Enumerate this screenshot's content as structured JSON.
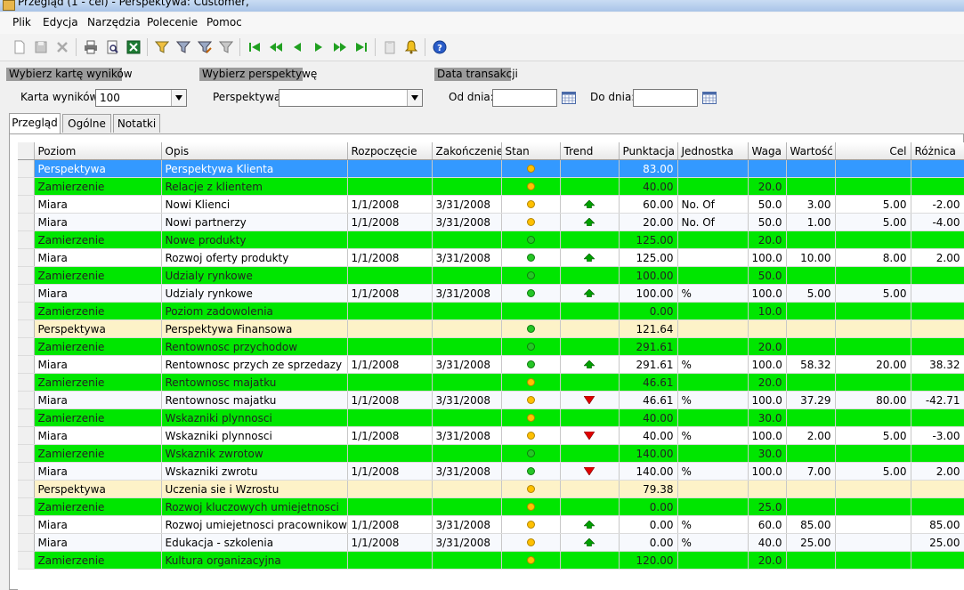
{
  "window": {
    "title": "Przegląd (1 - cel) - Perspektywa: Customer,"
  },
  "menu": [
    "Plik",
    "Edycja",
    "Narzędzia",
    "Polecenie",
    "Pomoc"
  ],
  "toolbar": [
    "new-icon",
    "save-icon",
    "delete-icon",
    "print-icon",
    "print-preview-icon",
    "excel-export-icon",
    "filter-icon",
    "filter-apply-icon",
    "filter-edit-icon",
    "filter-clear-icon",
    "first-record-icon",
    "previous-page-icon",
    "previous-record-icon",
    "next-record-icon",
    "next-page-icon",
    "last-record-icon",
    "attachment-icon",
    "alert-bell-icon",
    "help-icon"
  ],
  "filters": {
    "scorecard": {
      "section": "Wybierz kartę wyników",
      "label": "Karta wyników:",
      "value": "100"
    },
    "perspective": {
      "section": "Wybierz perspektywę",
      "label": "Perspektywa:",
      "value": ""
    },
    "date": {
      "section": "Data transakcji",
      "from_label": "Od dnia:",
      "to_label": "Do dnia:",
      "from_value": "",
      "to_value": ""
    }
  },
  "tabs": [
    "Przegląd",
    "Ogólne",
    "Notatki"
  ],
  "colors": {
    "perspektywa": "#fdf2c8",
    "zamierzenie": "#00e600",
    "selected": "#3399ff",
    "status_yellow": "#ffc000",
    "status_green": "#26c626",
    "trend_up": "#00a000",
    "trend_down": "#e00000"
  },
  "grid": {
    "columns": [
      "Poziom",
      "Opis",
      "Rozpoczęcie",
      "Zakończenie",
      "Stan",
      "Trend",
      "Punktacja",
      "Jednostka",
      "Waga",
      "Wartość",
      "Cel",
      "Różnica"
    ],
    "rows": [
      {
        "type": "perspektywa",
        "selected": true,
        "poziom": "Perspektywa",
        "opis": "Perspektywa Klienta",
        "start": "",
        "end": "",
        "stan": "yellow",
        "trend": "",
        "punktacja": "83.00",
        "jednostka": "",
        "waga": "",
        "wartosc": "",
        "cel": "",
        "roznica": ""
      },
      {
        "type": "zamierzenie",
        "poziom": "Zamierzenie",
        "opis": "Relacje z klientem",
        "start": "",
        "end": "",
        "stan": "yellow",
        "trend": "",
        "punktacja": "40.00",
        "jednostka": "",
        "waga": "20.0",
        "wartosc": "",
        "cel": "",
        "roznica": ""
      },
      {
        "type": "miara",
        "poziom": "Miara",
        "opis": "Nowi Klienci",
        "start": "1/1/2008",
        "end": "3/31/2008",
        "stan": "yellow",
        "trend": "up",
        "punktacja": "60.00",
        "jednostka": "No. Of",
        "waga": "50.0",
        "wartosc": "3.00",
        "cel": "5.00",
        "roznica": "-2.00"
      },
      {
        "type": "miara",
        "poziom": "Miara",
        "opis": "Nowi partnerzy",
        "start": "1/1/2008",
        "end": "3/31/2008",
        "stan": "yellow",
        "trend": "up",
        "punktacja": "20.00",
        "jednostka": "No. Of",
        "waga": "50.0",
        "wartosc": "1.00",
        "cel": "5.00",
        "roznica": "-4.00"
      },
      {
        "type": "zamierzenie",
        "poziom": "Zamierzenie",
        "opis": "Nowe produkty",
        "start": "",
        "end": "",
        "stan": "green",
        "trend": "",
        "punktacja": "125.00",
        "jednostka": "",
        "waga": "20.0",
        "wartosc": "",
        "cel": "",
        "roznica": ""
      },
      {
        "type": "miara",
        "poziom": "Miara",
        "opis": "Rozwoj oferty produkty",
        "start": "1/1/2008",
        "end": "3/31/2008",
        "stan": "green",
        "trend": "up",
        "punktacja": "125.00",
        "jednostka": "",
        "waga": "100.0",
        "wartosc": "10.00",
        "cel": "8.00",
        "roznica": "2.00"
      },
      {
        "type": "zamierzenie",
        "poziom": "Zamierzenie",
        "opis": "Udzialy rynkowe",
        "start": "",
        "end": "",
        "stan": "green",
        "trend": "",
        "punktacja": "100.00",
        "jednostka": "",
        "waga": "50.0",
        "wartosc": "",
        "cel": "",
        "roznica": ""
      },
      {
        "type": "miara",
        "poziom": "Miara",
        "opis": "Udzialy rynkowe",
        "start": "1/1/2008",
        "end": "3/31/2008",
        "stan": "green",
        "trend": "up",
        "punktacja": "100.00",
        "jednostka": "%",
        "waga": "100.0",
        "wartosc": "5.00",
        "cel": "5.00",
        "roznica": ""
      },
      {
        "type": "zamierzenie",
        "poziom": "Zamierzenie",
        "opis": "Poziom zadowolenia",
        "start": "",
        "end": "",
        "stan": "",
        "trend": "",
        "punktacja": "0.00",
        "jednostka": "",
        "waga": "10.0",
        "wartosc": "",
        "cel": "",
        "roznica": ""
      },
      {
        "type": "perspektywa",
        "poziom": "Perspektywa",
        "opis": "Perspektywa Finansowa",
        "start": "",
        "end": "",
        "stan": "green",
        "trend": "",
        "punktacja": "121.64",
        "jednostka": "",
        "waga": "",
        "wartosc": "",
        "cel": "",
        "roznica": ""
      },
      {
        "type": "zamierzenie",
        "poziom": "Zamierzenie",
        "opis": "Rentownosc przychodow",
        "start": "",
        "end": "",
        "stan": "green",
        "trend": "",
        "punktacja": "291.61",
        "jednostka": "",
        "waga": "20.0",
        "wartosc": "",
        "cel": "",
        "roznica": ""
      },
      {
        "type": "miara",
        "poziom": "Miara",
        "opis": "Rentownosc przych ze sprzedazy",
        "start": "1/1/2008",
        "end": "3/31/2008",
        "stan": "green",
        "trend": "up",
        "punktacja": "291.61",
        "jednostka": "%",
        "waga": "100.0",
        "wartosc": "58.32",
        "cel": "20.00",
        "roznica": "38.32"
      },
      {
        "type": "zamierzenie",
        "poziom": "Zamierzenie",
        "opis": "Rentownosc majatku",
        "start": "",
        "end": "",
        "stan": "yellow",
        "trend": "",
        "punktacja": "46.61",
        "jednostka": "",
        "waga": "20.0",
        "wartosc": "",
        "cel": "",
        "roznica": ""
      },
      {
        "type": "miara",
        "poziom": "Miara",
        "opis": "Rentownosc majatku",
        "start": "1/1/2008",
        "end": "3/31/2008",
        "stan": "yellow",
        "trend": "down",
        "punktacja": "46.61",
        "jednostka": "%",
        "waga": "100.0",
        "wartosc": "37.29",
        "cel": "80.00",
        "roznica": "-42.71"
      },
      {
        "type": "zamierzenie",
        "poziom": "Zamierzenie",
        "opis": "Wskazniki plynnosci",
        "start": "",
        "end": "",
        "stan": "yellow",
        "trend": "",
        "punktacja": "40.00",
        "jednostka": "",
        "waga": "30.0",
        "wartosc": "",
        "cel": "",
        "roznica": ""
      },
      {
        "type": "miara",
        "poziom": "Miara",
        "opis": "Wskazniki plynnosci",
        "start": "1/1/2008",
        "end": "3/31/2008",
        "stan": "yellow",
        "trend": "down",
        "punktacja": "40.00",
        "jednostka": "%",
        "waga": "100.0",
        "wartosc": "2.00",
        "cel": "5.00",
        "roznica": "-3.00"
      },
      {
        "type": "zamierzenie",
        "poziom": "Zamierzenie",
        "opis": "Wskaznik zwrotow",
        "start": "",
        "end": "",
        "stan": "green",
        "trend": "",
        "punktacja": "140.00",
        "jednostka": "",
        "waga": "30.0",
        "wartosc": "",
        "cel": "",
        "roznica": ""
      },
      {
        "type": "miara",
        "poziom": "Miara",
        "opis": "Wskazniki zwrotu",
        "start": "1/1/2008",
        "end": "3/31/2008",
        "stan": "green",
        "trend": "down",
        "punktacja": "140.00",
        "jednostka": "%",
        "waga": "100.0",
        "wartosc": "7.00",
        "cel": "5.00",
        "roznica": "2.00"
      },
      {
        "type": "perspektywa",
        "poziom": "Perspektywa",
        "opis": "Uczenia sie i Wzrostu",
        "start": "",
        "end": "",
        "stan": "yellow",
        "trend": "",
        "punktacja": "79.38",
        "jednostka": "",
        "waga": "",
        "wartosc": "",
        "cel": "",
        "roznica": ""
      },
      {
        "type": "zamierzenie",
        "poziom": "Zamierzenie",
        "opis": "Rozwoj kluczowych umiejetnosci",
        "start": "",
        "end": "",
        "stan": "yellow",
        "trend": "",
        "punktacja": "0.00",
        "jednostka": "",
        "waga": "25.0",
        "wartosc": "",
        "cel": "",
        "roznica": ""
      },
      {
        "type": "miara",
        "poziom": "Miara",
        "opis": "Rozwoj umiejetnosci pracownikow",
        "start": "1/1/2008",
        "end": "3/31/2008",
        "stan": "yellow",
        "trend": "up",
        "punktacja": "0.00",
        "jednostka": "%",
        "waga": "60.0",
        "wartosc": "85.00",
        "cel": "",
        "roznica": "85.00"
      },
      {
        "type": "miara",
        "poziom": "Miara",
        "opis": "Edukacja - szkolenia",
        "start": "1/1/2008",
        "end": "3/31/2008",
        "stan": "yellow",
        "trend": "up",
        "punktacja": "0.00",
        "jednostka": "%",
        "waga": "40.0",
        "wartosc": "25.00",
        "cel": "",
        "roznica": "25.00"
      },
      {
        "type": "zamierzenie",
        "poziom": "Zamierzenie",
        "opis": "Kultura organizacyjna",
        "start": "",
        "end": "",
        "stan": "yellow",
        "trend": "",
        "punktacja": "120.00",
        "jednostka": "",
        "waga": "20.0",
        "wartosc": "",
        "cel": "",
        "roznica": ""
      }
    ]
  }
}
